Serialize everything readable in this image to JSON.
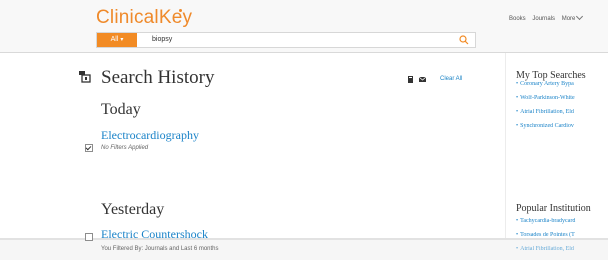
{
  "header": {
    "logo": "ClinicalKey",
    "search": {
      "scope": "All",
      "query": "biopsy"
    },
    "nav": [
      "Books",
      "Journals",
      "More"
    ]
  },
  "history": {
    "title": "Search History",
    "clear_all": "Clear All",
    "today_label": "Today",
    "today_item": {
      "title": "Electrocardiography",
      "meta": "No Filters Applied",
      "checked": true
    },
    "yesterday_label": "Yesterday",
    "yesterday_item": {
      "title": "Electric Countershock",
      "meta": "You Filtered By: Journals and Last 6 months",
      "checked": false
    }
  },
  "top_searches": {
    "title": "My Top Searches",
    "items": [
      "Coronary Artery Bypa",
      "Wolf-Parkinson-White",
      "Atrial Fibrillation, Eld",
      "Synchronized Cardiov"
    ]
  },
  "popular": {
    "title": "Popular Institution",
    "items": [
      "Tachycardia-bradycard",
      "Torsades de Pointes (T",
      "Atrial Fibrillation, Eld"
    ]
  },
  "colors": {
    "brand_orange": "#ef8a2b",
    "link_blue": "#1a83c8"
  },
  "icons": {
    "history": "history-icon",
    "search": "search-icon",
    "print": "print-icon",
    "email": "email-icon"
  }
}
